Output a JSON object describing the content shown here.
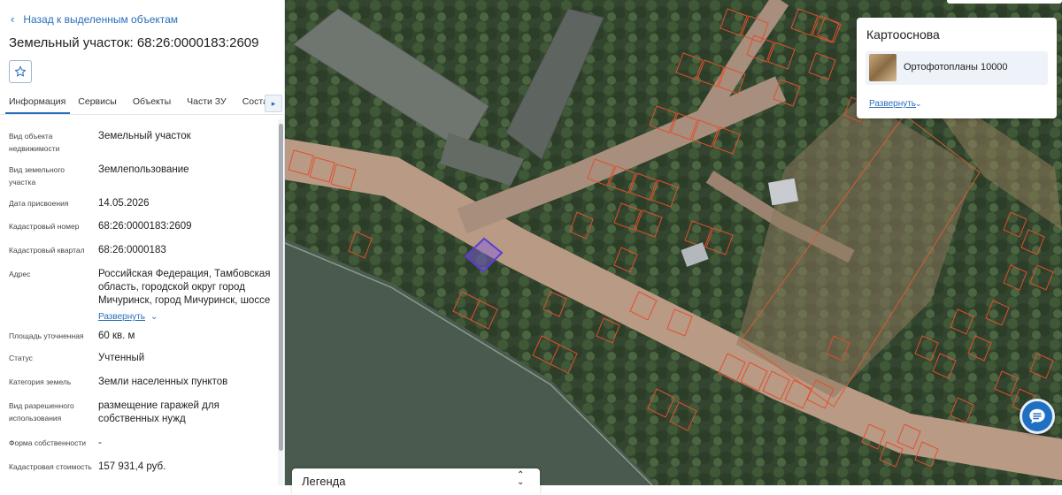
{
  "back_label": "Назад к выделенным объектам",
  "title": "Земельный участок: 68:26:0000183:2609",
  "favorite_icon": "star-icon",
  "tabs": [
    {
      "label": "Информация",
      "active": true
    },
    {
      "label": "Сервисы",
      "active": false
    },
    {
      "label": "Объекты",
      "active": false
    },
    {
      "label": "Части ЗУ",
      "active": false
    },
    {
      "label": "Состав",
      "active": false
    }
  ],
  "info": [
    {
      "label": "Вид объекта недвижимости",
      "value": "Земельный участок"
    },
    {
      "label": "Вид земельного участка",
      "value": "Землепользование"
    },
    {
      "label": "Дата присвоения",
      "value": "14.05.2026"
    },
    {
      "label": "Кадастровый номер",
      "value": "68:26:0000183:2609"
    },
    {
      "label": "Кадастровый квартал",
      "value": "68:26:0000183"
    },
    {
      "label": "Адрес",
      "value": "Российская Федерация, Тамбовская область, городской округ город Мичуринск, город Мичуринск, шоссе"
    },
    {
      "label": "Площадь уточненная",
      "value": "60 кв. м"
    },
    {
      "label": "Статус",
      "value": "Учтенный"
    },
    {
      "label": "Категория земель",
      "value": "Земли населенных пунктов"
    },
    {
      "label": "Вид разрешенного использования",
      "value": "размещение гаражей для собственных нужд"
    },
    {
      "label": "Форма собственности",
      "value": "-"
    },
    {
      "label": "Кадастровая стоимость",
      "value": "157 931,4 руб."
    }
  ],
  "address_expand": "Развернуть",
  "basemap": {
    "title": "Картооснова",
    "item_label": "Ортофотопланы 10000",
    "expand": "Развернуть"
  },
  "legend_title": "Легенда",
  "colors": {
    "accent": "#2a6ebb",
    "parcel_outline": "#e0502f",
    "selected_parcel": "#5a3fd1"
  }
}
